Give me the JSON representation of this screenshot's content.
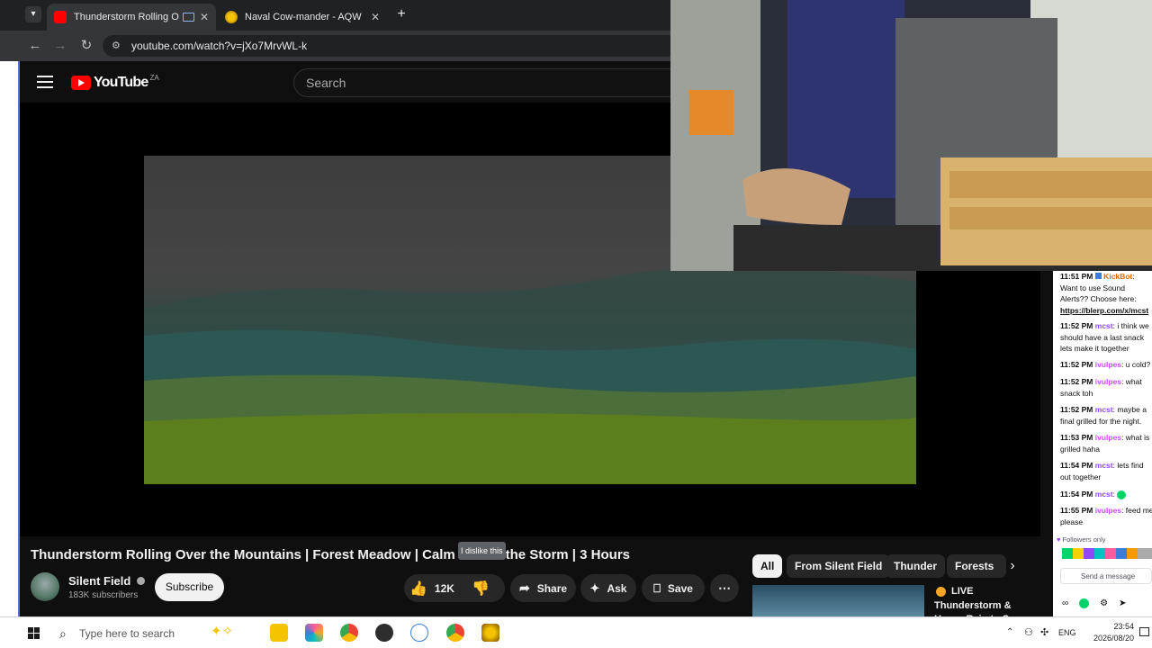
{
  "browser": {
    "tabs": [
      {
        "title": "Thunderstorm Rolling Over",
        "active": true
      },
      {
        "title": "Naval Cow-mander - AQW",
        "active": false
      }
    ],
    "url": "youtube.com/watch?v=jXo7MrvWL-k"
  },
  "youtube": {
    "logo_text": "YouTube",
    "region": "ZA",
    "search_placeholder": "Search",
    "video_title": "Thunderstorm Rolling Over the Mountains | Forest Meadow | Calm Before the Storm | 3 Hours",
    "tooltip": "I dislike this",
    "channel": {
      "name": "Silent Field",
      "subscribers": "183K subscribers"
    },
    "subscribe_label": "Subscribe",
    "actions": {
      "likes": "12K",
      "share": "Share",
      "ask": "Ask",
      "save": "Save"
    },
    "chips": [
      "All",
      "From Silent Field",
      "Thunder",
      "Forests"
    ],
    "recommendation": {
      "badge": "LIVE",
      "title": "Thunderstorm &",
      "subtitle": "Heavy Rain to S"
    }
  },
  "chat": {
    "messages": [
      {
        "time": "11:51 PM",
        "user": "KickBot",
        "text": "Want to use Sound Alerts?? Choose here:",
        "link": "https://blerp.com/x/mcst"
      },
      {
        "time": "11:52 PM",
        "user": "mcst",
        "text": "i think we should have a last snack lets make it together"
      },
      {
        "time": "11:52 PM",
        "user": "ivulpes",
        "text": "u cold?"
      },
      {
        "time": "11:52 PM",
        "user": "ivulpes",
        "text": "what snack toh"
      },
      {
        "time": "11:52 PM",
        "user": "mcst",
        "text": "maybe a final grilled for the night."
      },
      {
        "time": "11:53 PM",
        "user": "ivulpes",
        "text": "what is grilled haha"
      },
      {
        "time": "11:54 PM",
        "user": "mcst",
        "text": "lets find out together"
      },
      {
        "time": "11:54 PM",
        "user": "mcst",
        "text": ""
      },
      {
        "time": "11:55 PM",
        "user": "ivulpes",
        "text": "feed me please"
      }
    ],
    "followers_only": "Followers only",
    "send_placeholder": "Send a message"
  },
  "taskbar": {
    "search_placeholder": "Type here to search",
    "language": "ENG",
    "time": "23:54",
    "date": "2026/08/20"
  },
  "colors": {
    "yt_red": "#ff0000",
    "yt_bg": "#0f0f0f",
    "twitch_purple": "#9147ff",
    "twitch_green": "#00d36a"
  }
}
